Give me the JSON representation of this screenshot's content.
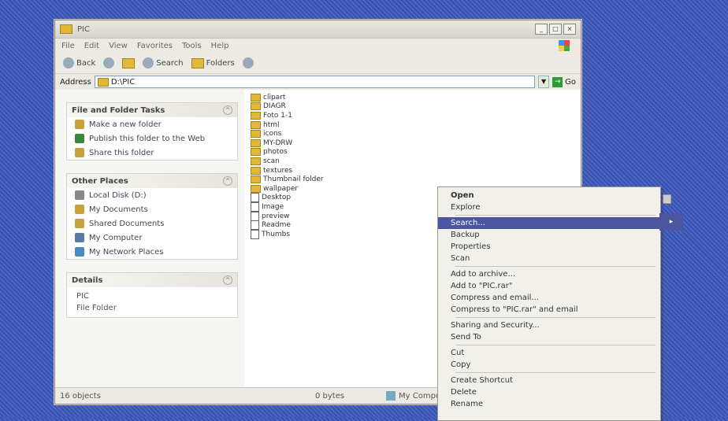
{
  "window": {
    "title": "PIC"
  },
  "menu": {
    "items": [
      "File",
      "Edit",
      "View",
      "Favorites",
      "Tools",
      "Help"
    ]
  },
  "toolbar": {
    "back_label": "Back",
    "search_label": "Search",
    "folders_label": "Folders"
  },
  "address": {
    "label": "Address",
    "value": "D:\\PIC",
    "go_label": "Go"
  },
  "task_pane": {
    "file_tasks": {
      "title": "File and Folder Tasks",
      "items": [
        "Make a new folder",
        "Publish this folder to the Web",
        "Share this folder"
      ]
    },
    "other_places": {
      "title": "Other Places",
      "items": [
        "Local Disk (D:)",
        "My Documents",
        "Shared Documents",
        "My Computer",
        "My Network Places"
      ]
    },
    "details": {
      "title": "Details",
      "lines": [
        "PIC",
        "File Folder"
      ]
    }
  },
  "files": [
    {
      "name": "clipart",
      "type": "folder"
    },
    {
      "name": "DIAGR",
      "type": "folder"
    },
    {
      "name": "Foto 1-1",
      "type": "folder"
    },
    {
      "name": "html",
      "type": "folder"
    },
    {
      "name": "icons",
      "type": "folder"
    },
    {
      "name": "MY-DRW",
      "type": "folder"
    },
    {
      "name": "photos",
      "type": "folder"
    },
    {
      "name": "scan",
      "type": "folder"
    },
    {
      "name": "textures",
      "type": "folder"
    },
    {
      "name": "Thumbnail folder",
      "type": "folder"
    },
    {
      "name": "wallpaper",
      "type": "folder"
    },
    {
      "name": "Desktop",
      "type": "file"
    },
    {
      "name": "Image",
      "type": "file"
    },
    {
      "name": "preview",
      "type": "file"
    },
    {
      "name": "Readme",
      "type": "file"
    },
    {
      "name": "Thumbs",
      "type": "file"
    }
  ],
  "status": {
    "left": "16 objects",
    "size": "0 bytes",
    "location": "My Computer"
  },
  "context_menu": {
    "items": [
      {
        "label": "Open",
        "bold": true
      },
      {
        "label": "Explore"
      },
      {
        "sep": true
      },
      {
        "label": "Search...",
        "selected": true
      },
      {
        "label": "Backup"
      },
      {
        "label": "Properties"
      },
      {
        "label": "Scan"
      },
      {
        "sep": true
      },
      {
        "label": "Add to archive..."
      },
      {
        "label": "Add to \"PIC.rar\""
      },
      {
        "label": "Compress and email..."
      },
      {
        "label": "Compress to \"PIC.rar\" and email"
      },
      {
        "sep": true
      },
      {
        "label": "Sharing and Security..."
      },
      {
        "label": "Send To"
      },
      {
        "sep": true
      },
      {
        "label": "Cut"
      },
      {
        "label": "Copy"
      },
      {
        "sep": true
      },
      {
        "label": "Create Shortcut"
      },
      {
        "label": "Delete"
      },
      {
        "label": "Rename"
      }
    ],
    "submenu_marker": "▸"
  }
}
